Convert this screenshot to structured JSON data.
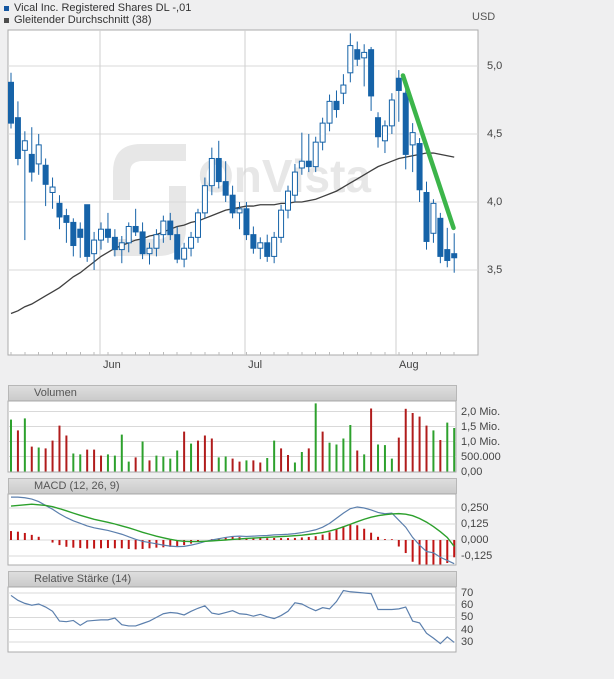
{
  "legend": {
    "series": [
      {
        "label": "Vical Inc. Registered Shares DL -,01",
        "color": "#1456a0"
      },
      {
        "label": "Gleitender Durchschnitt (38)",
        "color": "#4d4d4d"
      }
    ]
  },
  "watermark": {
    "text": "OnVista"
  },
  "colors": {
    "candle": "#1663a8",
    "ma_line": "#3f3f3f",
    "vol_up": "#2da12d",
    "vol_down": "#b01c1c",
    "macd_line": "#5b7fad",
    "signal_line": "#2ca02c",
    "histogram": "#c01414",
    "rsi_line": "#5b7fad",
    "trend": "#3cb54a",
    "grid": "#d9d9d9",
    "month_grid": "#cfcfcf",
    "plot_border": "#ababab",
    "watermark_gray": "#e7e7e7"
  },
  "chart_data": [
    {
      "id": "price",
      "type": "candlestick",
      "title": "Vical Inc. Registered Shares DL -,01",
      "unit": "USD",
      "ylim": [
        2.9,
        5.26
      ],
      "y_ticks": [
        {
          "value": 5.0,
          "label": "5,0"
        },
        {
          "value": 4.5,
          "label": "4,5"
        },
        {
          "value": 4.0,
          "label": "4,0"
        },
        {
          "value": 3.5,
          "label": "3,5"
        }
      ],
      "x_ticks": [
        {
          "index": 12.85,
          "label": "Jun"
        },
        {
          "index": 33.8,
          "label": "Jul"
        },
        {
          "index": 55.6,
          "label": "Aug"
        }
      ],
      "candles": [
        [
          4.88,
          4.95,
          4.54,
          4.58
        ],
        [
          4.62,
          4.74,
          4.27,
          4.32
        ],
        [
          4.38,
          4.52,
          3.72,
          4.45
        ],
        [
          4.35,
          4.55,
          4.15,
          4.22
        ],
        [
          4.28,
          4.5,
          4.2,
          4.42
        ],
        [
          4.27,
          4.32,
          3.97,
          4.13
        ],
        [
          4.07,
          4.18,
          3.95,
          4.11
        ],
        [
          3.99,
          4.05,
          3.8,
          3.89
        ],
        [
          3.9,
          3.95,
          3.7,
          3.85
        ],
        [
          3.85,
          3.88,
          3.6,
          3.68
        ],
        [
          3.8,
          3.85,
          3.59,
          3.74
        ],
        [
          3.98,
          3.98,
          3.56,
          3.6
        ],
        [
          3.62,
          3.78,
          3.5,
          3.72
        ],
        [
          3.72,
          3.85,
          3.65,
          3.8
        ],
        [
          3.8,
          3.92,
          3.7,
          3.74
        ],
        [
          3.74,
          3.8,
          3.6,
          3.65
        ],
        [
          3.65,
          3.75,
          3.55,
          3.7
        ],
        [
          3.7,
          3.85,
          3.63,
          3.82
        ],
        [
          3.82,
          3.95,
          3.75,
          3.78
        ],
        [
          3.78,
          3.85,
          3.58,
          3.62
        ],
        [
          3.62,
          3.7,
          3.54,
          3.66
        ],
        [
          3.66,
          3.8,
          3.6,
          3.76
        ],
        [
          3.76,
          3.9,
          3.7,
          3.86
        ],
        [
          3.86,
          3.92,
          3.72,
          3.76
        ],
        [
          3.76,
          3.82,
          3.55,
          3.58
        ],
        [
          3.58,
          3.7,
          3.52,
          3.66
        ],
        [
          3.66,
          3.78,
          3.6,
          3.74
        ],
        [
          3.74,
          3.95,
          3.7,
          3.92
        ],
        [
          3.92,
          4.18,
          3.88,
          4.12
        ],
        [
          4.12,
          4.4,
          4.05,
          4.32
        ],
        [
          4.32,
          4.45,
          4.1,
          4.15
        ],
        [
          4.15,
          4.3,
          4.0,
          4.05
        ],
        [
          4.05,
          4.12,
          3.88,
          3.92
        ],
        [
          3.92,
          4.0,
          3.8,
          3.95
        ],
        [
          3.95,
          4.0,
          3.72,
          3.76
        ],
        [
          3.76,
          3.82,
          3.62,
          3.66
        ],
        [
          3.66,
          3.74,
          3.58,
          3.7
        ],
        [
          3.7,
          3.76,
          3.56,
          3.6
        ],
        [
          3.6,
          3.78,
          3.55,
          3.74
        ],
        [
          3.74,
          3.98,
          3.7,
          3.94
        ],
        [
          3.94,
          4.12,
          3.88,
          4.08
        ],
        [
          4.05,
          4.28,
          4.0,
          4.22
        ],
        [
          4.25,
          4.51,
          4.2,
          4.3
        ],
        [
          4.3,
          4.5,
          4.22,
          4.26
        ],
        [
          4.26,
          4.48,
          4.22,
          4.44
        ],
        [
          4.44,
          4.62,
          4.38,
          4.58
        ],
        [
          4.58,
          4.79,
          4.52,
          4.74
        ],
        [
          4.74,
          4.82,
          4.62,
          4.68
        ],
        [
          4.8,
          4.94,
          4.72,
          4.86
        ],
        [
          4.95,
          5.24,
          4.88,
          5.15
        ],
        [
          5.12,
          5.18,
          5.0,
          5.05
        ],
        [
          5.06,
          5.16,
          4.85,
          5.1
        ],
        [
          5.12,
          5.14,
          4.67,
          4.78
        ],
        [
          4.62,
          4.66,
          4.4,
          4.48
        ],
        [
          4.45,
          4.6,
          4.36,
          4.56
        ],
        [
          4.56,
          4.8,
          4.5,
          4.75
        ],
        [
          4.91,
          4.97,
          4.59,
          4.82
        ],
        [
          4.8,
          4.85,
          4.24,
          4.35
        ],
        [
          4.42,
          4.58,
          4.22,
          4.51
        ],
        [
          4.43,
          4.47,
          4.0,
          4.09
        ],
        [
          4.07,
          4.15,
          3.65,
          3.71
        ],
        [
          3.77,
          4.02,
          3.7,
          3.99
        ],
        [
          3.88,
          3.92,
          3.55,
          3.6
        ],
        [
          3.65,
          3.81,
          3.52,
          3.57
        ],
        [
          3.62,
          3.77,
          3.48,
          3.59
        ]
      ],
      "moving_average": {
        "label": "Gleitender Durchschnitt (38)",
        "values": [
          3.18,
          3.2,
          3.23,
          3.25,
          3.28,
          3.31,
          3.34,
          3.37,
          3.41,
          3.45,
          3.48,
          3.52,
          3.56,
          3.6,
          3.63,
          3.66,
          3.68,
          3.7,
          3.72,
          3.73,
          3.75,
          3.76,
          3.78,
          3.8,
          3.82,
          3.83,
          3.85,
          3.86,
          3.88,
          3.9,
          3.92,
          3.94,
          3.95,
          3.96,
          3.97,
          3.97,
          3.98,
          3.98,
          3.98,
          3.99,
          3.99,
          4.0,
          4.0,
          4.01,
          4.02,
          4.04,
          4.06,
          4.08,
          4.11,
          4.14,
          4.17,
          4.2,
          4.23,
          4.26,
          4.28,
          4.3,
          4.32,
          4.33,
          4.34,
          4.35,
          4.36,
          4.36,
          4.35,
          4.34,
          4.33
        ]
      },
      "trendline": {
        "from_index": 56.6,
        "from_price": 4.93,
        "to_index": 63.9,
        "to_price": 3.81
      }
    },
    {
      "id": "volume",
      "type": "bar",
      "title": "Volumen",
      "y_ticks": [
        {
          "value": 2.0,
          "label": "2,0 Mio."
        },
        {
          "value": 1.5,
          "label": "1,5 Mio."
        },
        {
          "value": 1.0,
          "label": "1,0 Mio."
        },
        {
          "value": 0.5,
          "label": "500.000"
        },
        {
          "value": 0.0,
          "label": "0,00"
        }
      ],
      "values": [
        1.73,
        1.37,
        1.77,
        0.83,
        0.8,
        0.77,
        1.03,
        1.53,
        1.2,
        0.6,
        0.57,
        0.73,
        0.73,
        0.53,
        0.57,
        0.53,
        1.23,
        0.33,
        0.47,
        1.0,
        0.37,
        0.53,
        0.5,
        0.43,
        0.7,
        1.33,
        0.93,
        1.03,
        1.2,
        1.1,
        0.47,
        0.5,
        0.43,
        0.33,
        0.37,
        0.37,
        0.3,
        0.45,
        1.03,
        0.77,
        0.55,
        0.3,
        0.65,
        0.77,
        2.27,
        1.33,
        0.96,
        0.9,
        1.1,
        1.55,
        0.7,
        0.57,
        2.1,
        0.9,
        0.88,
        0.43,
        1.13,
        2.09,
        1.95,
        1.83,
        1.53,
        1.37,
        1.05,
        1.63,
        1.45
      ],
      "colors": [
        "g",
        "r",
        "g",
        "r",
        "g",
        "r",
        "r",
        "r",
        "r",
        "g",
        "g",
        "r",
        "r",
        "r",
        "g",
        "g",
        "g",
        "g",
        "r",
        "g",
        "r",
        "g",
        "g",
        "g",
        "g",
        "r",
        "g",
        "r",
        "r",
        "r",
        "g",
        "g",
        "r",
        "r",
        "g",
        "r",
        "r",
        "g",
        "g",
        "r",
        "r",
        "g",
        "g",
        "r",
        "g",
        "r",
        "g",
        "g",
        "g",
        "g",
        "r",
        "g",
        "r",
        "g",
        "g",
        "g",
        "r",
        "r",
        "r",
        "r",
        "r",
        "g",
        "r",
        "g",
        "g"
      ]
    },
    {
      "id": "macd",
      "type": "line",
      "title": "MACD (12, 26, 9)",
      "y_ticks": [
        {
          "value": 0.25,
          "label": "0,250"
        },
        {
          "value": 0.125,
          "label": "0,125"
        },
        {
          "value": 0.0,
          "label": "0,000"
        },
        {
          "value": -0.125,
          "label": "-0,125"
        }
      ],
      "series": [
        {
          "name": "macd",
          "values": [
            0.335,
            0.335,
            0.33,
            0.32,
            0.3,
            0.27,
            0.24,
            0.205,
            0.175,
            0.15,
            0.13,
            0.11,
            0.095,
            0.085,
            0.075,
            0.06,
            0.045,
            0.025,
            0.005,
            -0.01,
            -0.02,
            -0.03,
            -0.04,
            -0.048,
            -0.052,
            -0.05,
            -0.04,
            -0.028,
            -0.012,
            0.0,
            0.01,
            0.02,
            0.028,
            0.03,
            0.028,
            0.03,
            0.033,
            0.035,
            0.04,
            0.042,
            0.045,
            0.05,
            0.058,
            0.068,
            0.08,
            0.1,
            0.13,
            0.17,
            0.21,
            0.245,
            0.258,
            0.25,
            0.235,
            0.215,
            0.205,
            0.21,
            0.155,
            0.1,
            0.02,
            -0.04,
            -0.09,
            -0.1,
            -0.135,
            -0.16,
            -0.185
          ]
        },
        {
          "name": "signal",
          "values": [
            0.265,
            0.27,
            0.275,
            0.28,
            0.275,
            0.27,
            0.26,
            0.245,
            0.228,
            0.21,
            0.193,
            0.177,
            0.162,
            0.15,
            0.138,
            0.125,
            0.11,
            0.095,
            0.078,
            0.06,
            0.045,
            0.03,
            0.017,
            0.005,
            -0.004,
            -0.01,
            -0.012,
            -0.012,
            -0.01,
            -0.007,
            -0.003,
            0.0,
            0.004,
            0.008,
            0.012,
            0.015,
            0.018,
            0.021,
            0.024,
            0.027,
            0.03,
            0.034,
            0.038,
            0.044,
            0.05,
            0.058,
            0.07,
            0.085,
            0.103,
            0.123,
            0.143,
            0.162,
            0.178,
            0.19,
            0.198,
            0.204,
            0.206,
            0.202,
            0.19,
            0.168,
            0.14,
            0.105,
            0.065,
            0.02,
            -0.05
          ]
        }
      ]
    },
    {
      "id": "rsi",
      "type": "line",
      "title": "Relative Stärke (14)",
      "y_ticks": [
        {
          "value": 70,
          "label": "70"
        },
        {
          "value": 60,
          "label": "60"
        },
        {
          "value": 50,
          "label": "50"
        },
        {
          "value": 40,
          "label": "40"
        },
        {
          "value": 30,
          "label": "30"
        }
      ],
      "values": [
        68,
        64,
        61.5,
        60,
        61,
        58.5,
        55,
        47,
        46.5,
        47.5,
        43.5,
        47,
        47.5,
        48,
        48,
        49.5,
        44,
        43,
        43,
        45,
        47,
        50,
        53,
        54,
        53.5,
        52,
        55,
        57.5,
        59.5,
        53.5,
        52.5,
        54,
        55.5,
        53,
        52.5,
        51,
        52.5,
        50.5,
        49,
        51.5,
        55,
        62,
        61,
        58,
        55.5,
        58,
        57,
        63,
        72,
        71,
        70.5,
        70,
        69.5,
        56.5,
        56.5,
        56.5,
        57,
        58.5,
        47,
        45.5,
        37,
        33,
        28.5,
        34,
        29.5
      ]
    }
  ]
}
